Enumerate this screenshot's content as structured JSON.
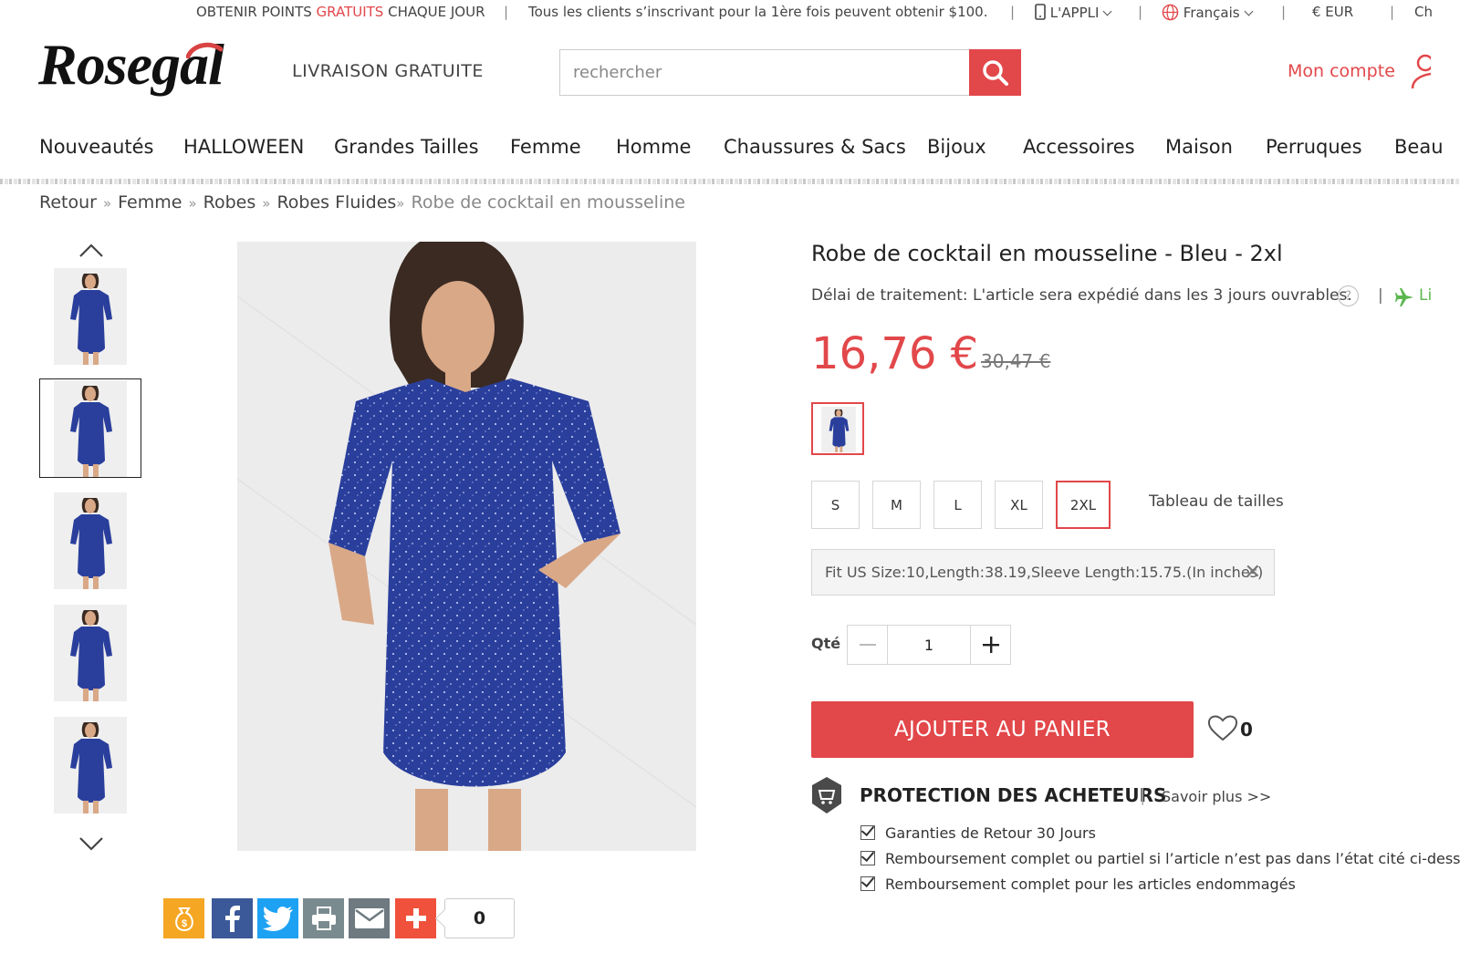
{
  "topbar": {
    "points_a": "OBTENIR POINTS ",
    "points_b": "GRATUITS",
    "points_c": " CHAQUE JOUR",
    "promo": "Tous les clients s’inscrivant pour la 1ère fois peuvent obtenir $100.",
    "app": "L'APPLI",
    "language": "Français",
    "currency": "€ EUR",
    "cut": "Ch"
  },
  "header": {
    "logo": "Rosegal",
    "free_shipping": "LIVRAISON GRATUITE",
    "search_placeholder": "rechercher",
    "account": "Mon compte"
  },
  "nav": [
    "Nouveautés",
    "HALLOWEEN",
    "Grandes Tailles",
    "Femme",
    "Homme",
    "Chaussures & Sacs",
    "Bijoux",
    "Accessoires",
    "Maison",
    "Perruques",
    "Beau"
  ],
  "breadcrumb": {
    "items": [
      "Retour",
      "Femme",
      "Robes",
      "Robes Fluides"
    ],
    "current": "Robe de cocktail en mousseline"
  },
  "product": {
    "title": "Robe de cocktail en mousseline - Bleu - 2xl",
    "processing": "Délai de traitement: L'article sera expédié dans les 3 jours ouvrables.",
    "ship_cut": "Li",
    "price": "16,76 €",
    "old_price": "30,47 €",
    "sizes": [
      "S",
      "M",
      "L",
      "XL",
      "2XL"
    ],
    "selected_size": "2XL",
    "size_chart": "Tableau de tailles",
    "fit_info": "Fit US Size:10,Length:38.19,Sleeve Length:15.75.(In inches)",
    "qty_label": "Qté",
    "qty": "1",
    "add_to_cart": "AJOUTER AU PANIER",
    "wishlist_count": "0"
  },
  "protection": {
    "title": "PROTECTION DES ACHETEURS",
    "learn_more": "Savoir plus >>",
    "items": [
      "Garanties de Retour 30 Jours",
      "Remboursement complet ou partiel si l’article n’est pas dans l’état cité ci-dess",
      "Remboursement complet pour les articles endommagés"
    ]
  },
  "share": {
    "count": "0"
  },
  "colors": {
    "accent": "#e2474a",
    "dress": "#2a3f9c",
    "facebook": "#3b5998",
    "twitter": "#1da1f2",
    "print": "#7a8b8f",
    "email": "#6e7a80",
    "plus": "#f0513c",
    "coin": "#f5a623"
  }
}
